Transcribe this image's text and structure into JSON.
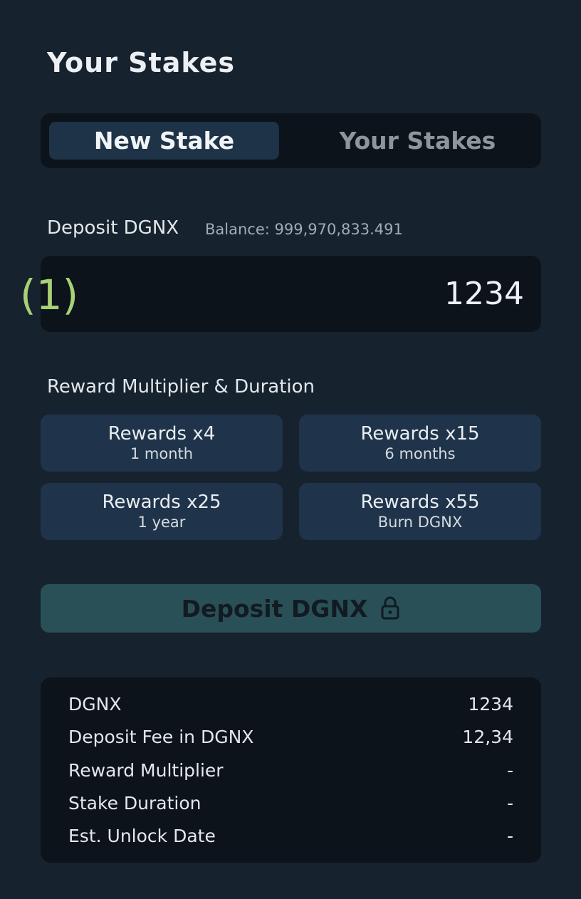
{
  "page": {
    "title": "Your Stakes"
  },
  "tabs": [
    {
      "label": "New Stake",
      "active": true
    },
    {
      "label": "Your Stakes",
      "active": false
    }
  ],
  "deposit": {
    "label": "Deposit DGNX",
    "balance": "Balance: 999,970,833.491",
    "amount": "1234",
    "annotation": "(1)"
  },
  "multiplier": {
    "label": "Reward Multiplier & Duration",
    "options": [
      {
        "title": "Rewards x4",
        "subtitle": "1 month"
      },
      {
        "title": "Rewards x15",
        "subtitle": "6 months"
      },
      {
        "title": "Rewards x25",
        "subtitle": "1 year"
      },
      {
        "title": "Rewards x55",
        "subtitle": "Burn DGNX"
      }
    ]
  },
  "deposit_button": {
    "label": "Deposit DGNX",
    "icon": "lock-icon",
    "disabled": true
  },
  "summary": {
    "rows": [
      {
        "label": "DGNX",
        "value": "1234"
      },
      {
        "label": "Deposit Fee in DGNX",
        "value": "12,34"
      },
      {
        "label": "Reward Multiplier",
        "value": "-"
      },
      {
        "label": "Stake Duration",
        "value": "-"
      },
      {
        "label": "Est. Unlock Date",
        "value": "-"
      }
    ]
  },
  "colors": {
    "background": "#17222f",
    "panel": "#0c131a",
    "active_tab": "#1e3347",
    "option_card": "#1f344a",
    "deposit_button": "#2a5057",
    "annotation": "#a8d075"
  }
}
